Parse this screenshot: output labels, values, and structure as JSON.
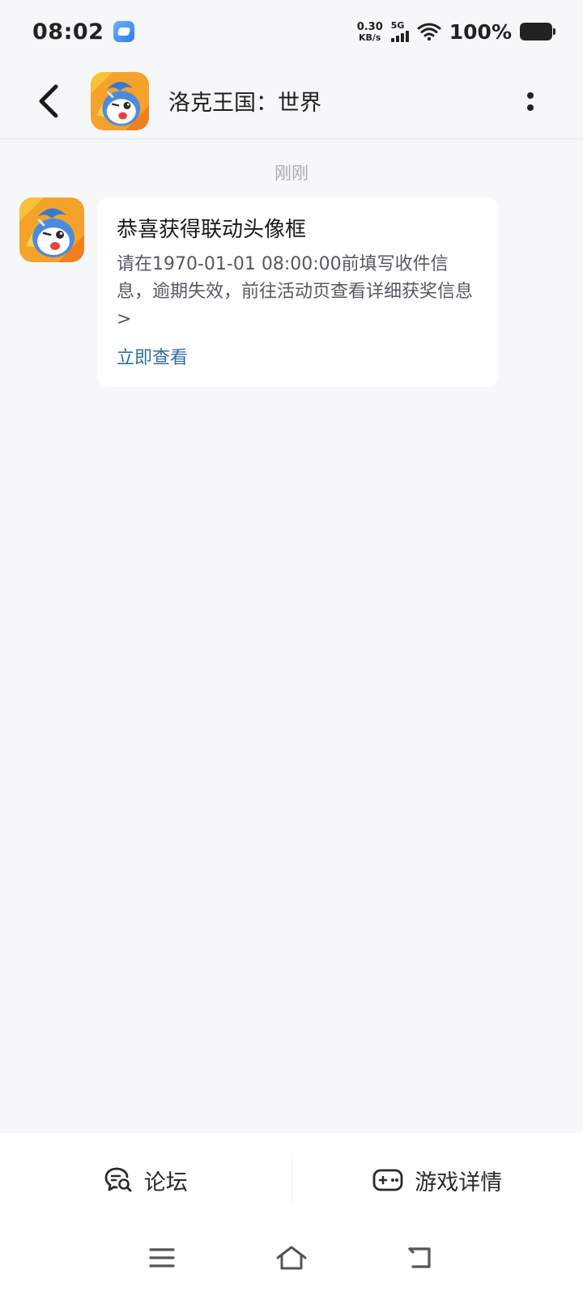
{
  "status_bar": {
    "time": "08:02",
    "net_speed_value": "0.30",
    "net_speed_unit": "KB/s",
    "network_type": "5G",
    "battery": "100%"
  },
  "header": {
    "title": "洛克王国：世界",
    "back_icon": "chevron-left-icon",
    "more_icon": "more-vertical-icon"
  },
  "chat": {
    "timestamp": "刚刚",
    "message": {
      "title": "恭喜获得联动头像框",
      "body": "请在1970-01-01 08:00:00前填写收件信息，逾期失效，前往活动页查看详细获奖信息>",
      "link_label": "立即查看"
    }
  },
  "bottom_bar": {
    "forum_label": "论坛",
    "forum_icon": "chat-search-icon",
    "game_details_label": "游戏详情",
    "game_details_icon": "gamepad-icon"
  },
  "colors": {
    "background": "#f6f7f9",
    "link": "#2d6ea6",
    "timestamp": "#a9adb5"
  }
}
